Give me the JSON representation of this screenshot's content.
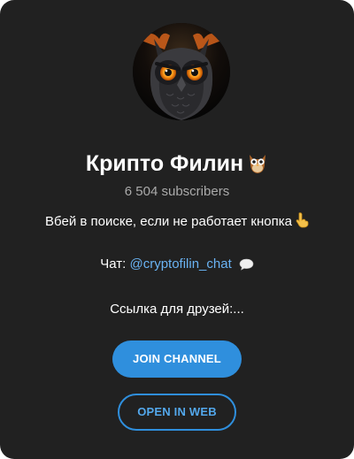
{
  "channel": {
    "avatar_icon": "owl-avatar",
    "title": "Крипто Филин",
    "title_emoji_icon": "owl-emoji-icon",
    "subscribers": "6 504 subscribers"
  },
  "description": {
    "line1": "Вбей в поиске, если не работает кнопка",
    "line1_emoji_icon": "pointing-down-hand-icon",
    "chat_label": "Чат:",
    "chat_link": "@cryptofilin_chat",
    "chat_emoji_icon": "speech-bubble-icon",
    "line3": "Ссылка для друзей:..."
  },
  "buttons": {
    "join_label": "JOIN CHANNEL",
    "web_label": "OPEN IN WEB"
  },
  "colors": {
    "background": "#212121",
    "accent": "#2f8fdd",
    "link": "#6ab3f3",
    "muted_text": "#aaaaaa",
    "text": "#ffffff"
  }
}
